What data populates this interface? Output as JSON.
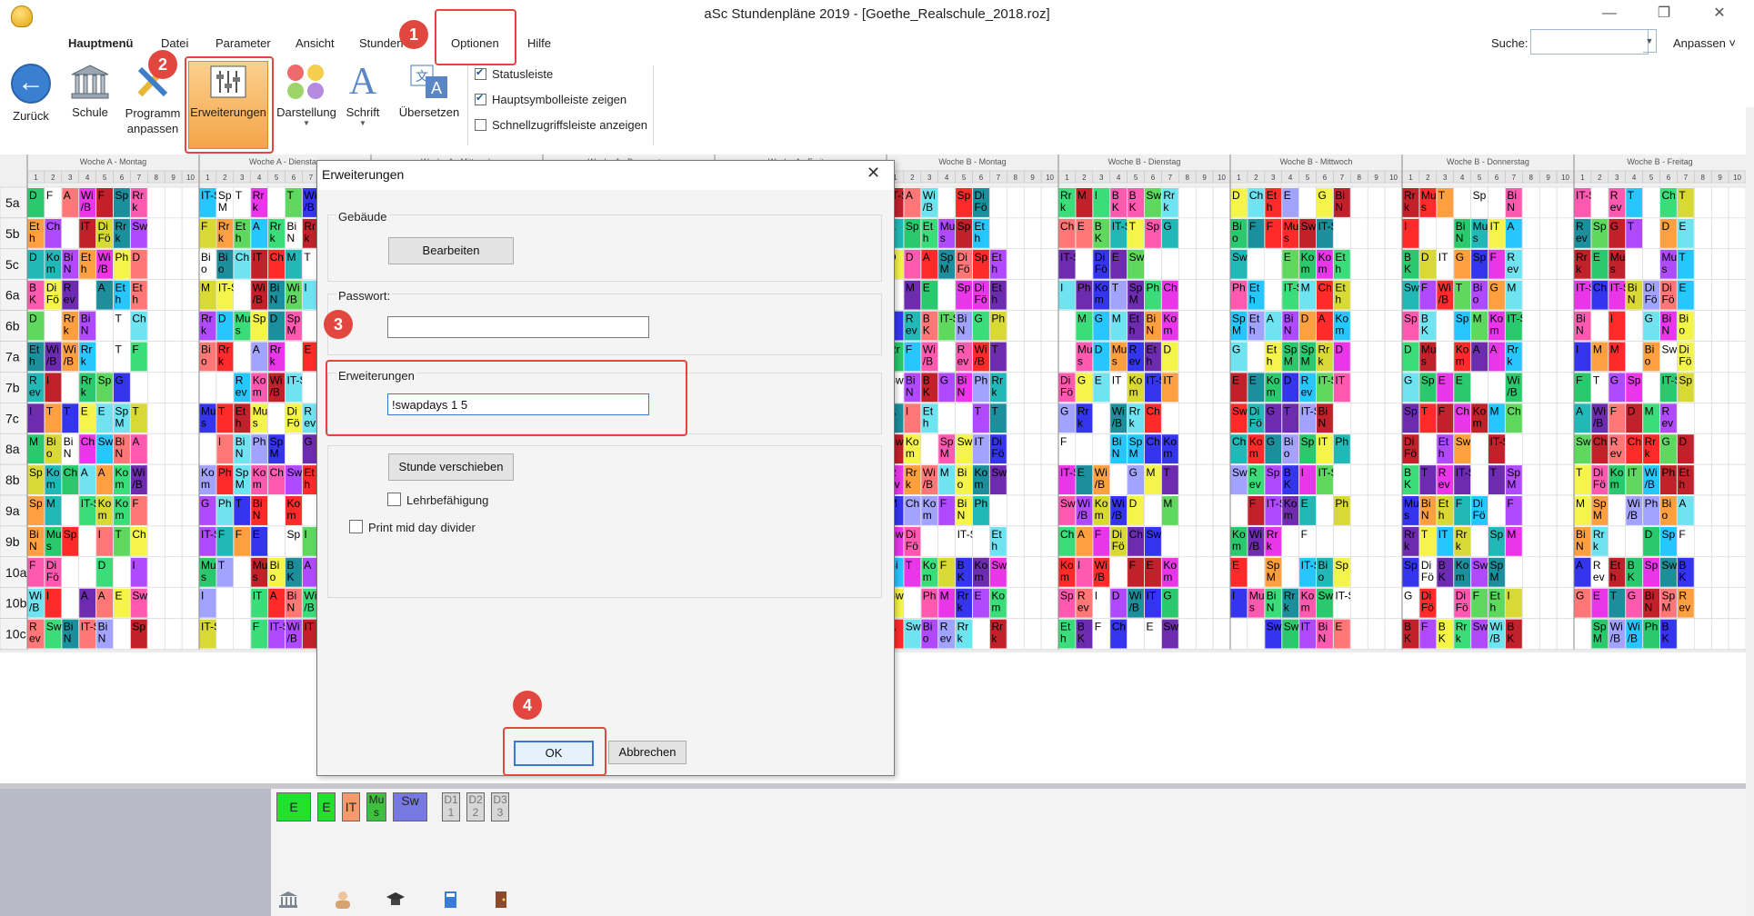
{
  "window": {
    "title": "aSc Stundenpläne 2019  - [Goethe_Realschule_2018.roz]",
    "minimize": "—",
    "maximize": "❐",
    "close": "✕"
  },
  "menu": {
    "tabs": [
      "Hauptmenü",
      "Datei",
      "Parameter",
      "Ansicht",
      "Stunden",
      "Optionen",
      "Hilfe"
    ],
    "search_label": "Suche:",
    "search_value": "",
    "customize_label": "Anpassen ˅"
  },
  "ribbon": {
    "back": "Zurück",
    "school": "Schule",
    "program_customize": "Programm anpassen",
    "extensions": "Erweiterungen",
    "display": "Darstellung",
    "font": "Schrift",
    "translate": "Übersetzen",
    "checkboxes": [
      {
        "label": "Statusleiste",
        "checked": true
      },
      {
        "label": "Hauptsymbolleiste zeigen",
        "checked": true
      },
      {
        "label": "Schnellzugriffsleiste anzeigen",
        "checked": false
      }
    ]
  },
  "timetable": {
    "days": [
      "Woche A - Montag",
      "Woche A - Dienstag",
      "Woche A - Mittwoch",
      "Woche A - Donnerstag",
      "Woche A - Freitag",
      "Woche B - Montag",
      "Woche B - Dienstag",
      "Woche B - Mittwoch",
      "Woche B - Donnerstag",
      "Woche B - Freitag"
    ],
    "periods": [
      "1",
      "2",
      "3",
      "4",
      "5",
      "6",
      "7",
      "8",
      "9",
      "10"
    ],
    "classes": [
      "5a",
      "5b",
      "5c",
      "6a",
      "6b",
      "7a",
      "7b",
      "7c",
      "8a",
      "8b",
      "9a",
      "9b",
      "10a",
      "10b",
      "10c"
    ],
    "subjects": [
      "M",
      "B K",
      "D",
      "Sp",
      "Rr k",
      "Bi o",
      "G",
      "Sw",
      "E",
      "IT",
      "Ph",
      "Ch",
      "F",
      "T",
      "A",
      "Mu s",
      "Di Fö",
      "R ev",
      "Et h",
      "Wi /B",
      "Ko m",
      "I",
      "Bi N",
      "Sp M",
      "IT-S"
    ]
  },
  "lower": {
    "cards": [
      "E",
      "E",
      "IT",
      "Mu s",
      "Sw",
      "D1 1",
      "D2 2",
      "D3 3"
    ]
  },
  "dialog": {
    "title": "Erweiterungen",
    "close": "✕",
    "building_label": "Gebäude",
    "edit_button": "Bearbeiten",
    "password_label": "Passwort:",
    "password_value": "",
    "extensions_label": "Erweiterungen",
    "extensions_value": "!swapdays 1 5",
    "move_lesson_button": "Stunde verschieben",
    "teacher_qualification": "Lehrbefähigung",
    "print_mid_day_divider": "Print mid day divider",
    "ok": "OK",
    "cancel": "Abbrechen"
  },
  "annotations": [
    "1",
    "2",
    "3",
    "4"
  ],
  "colors": {
    "accent_red": "#e2473f",
    "ribbon_selected": "#f6a94e",
    "link_blue": "#1e5aa8"
  }
}
